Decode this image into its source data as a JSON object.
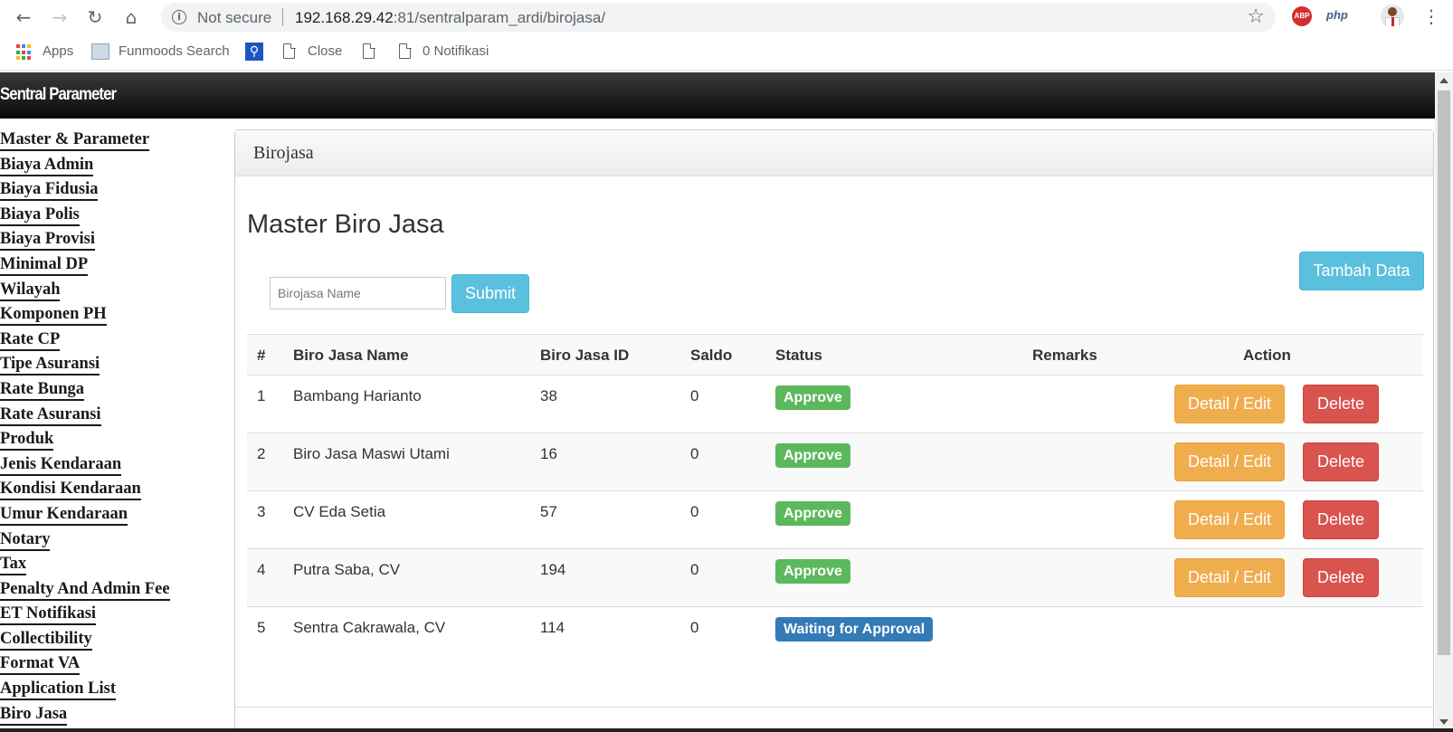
{
  "browser": {
    "security_label": "Not secure",
    "url_host": "192.168.29.42",
    "url_rest": ":81/sentralparam_ardi/birojasa/",
    "extensions": {
      "abp": "ABP",
      "php": "php"
    },
    "bookmarks": [
      {
        "label": "Apps",
        "icon": "apps-grid-icon"
      },
      {
        "label": "Funmoods Search",
        "icon": "funmoods-icon"
      },
      {
        "label": "",
        "icon": "search-icon"
      },
      {
        "label": "Close",
        "icon": "page-icon"
      },
      {
        "label": "",
        "icon": "page-icon"
      },
      {
        "label": "0 Notifikasi",
        "icon": "page-icon"
      }
    ]
  },
  "app": {
    "title": "Sentral Parameter"
  },
  "sidebar": {
    "items": [
      "Master & Parameter",
      "Biaya Admin",
      "Biaya Fidusia",
      "Biaya Polis",
      "Biaya Provisi",
      "Minimal DP",
      "Wilayah",
      "Komponen PH",
      "Rate CP",
      "Tipe Asuransi",
      "Rate Bunga",
      "Rate Asuransi",
      "Produk",
      "Jenis Kendaraan",
      "Kondisi Kendaraan",
      "Umur Kendaraan",
      "Notary",
      "Tax",
      "Penalty And Admin Fee",
      "ET Notifikasi",
      "Collectibility",
      "Format VA",
      "Application List",
      "Biro Jasa"
    ]
  },
  "panel": {
    "heading": "Birojasa",
    "title": "Master Biro Jasa",
    "search_placeholder": "Birojasa Name",
    "submit_label": "Submit",
    "add_label": "Tambah Data"
  },
  "table": {
    "columns": [
      "#",
      "Biro Jasa Name",
      "Biro Jasa ID",
      "Saldo",
      "Status",
      "Remarks",
      "Action"
    ],
    "rows": [
      {
        "no": "1",
        "name": "Bambang Harianto",
        "id": "38",
        "saldo": "0",
        "status": "Approve",
        "remarks": "",
        "edit": "Detail / Edit",
        "delete": "Delete"
      },
      {
        "no": "2",
        "name": "Biro Jasa Maswi Utami",
        "id": "16",
        "saldo": "0",
        "status": "Approve",
        "remarks": "",
        "edit": "Detail / Edit",
        "delete": "Delete"
      },
      {
        "no": "3",
        "name": "CV Eda Setia",
        "id": "57",
        "saldo": "0",
        "status": "Approve",
        "remarks": "",
        "edit": "Detail / Edit",
        "delete": "Delete"
      },
      {
        "no": "4",
        "name": "Putra Saba, CV",
        "id": "194",
        "saldo": "0",
        "status": "Approve",
        "remarks": "",
        "edit": "Detail / Edit",
        "delete": "Delete"
      },
      {
        "no": "5",
        "name": "Sentra Cakrawala, CV",
        "id": "114",
        "saldo": "0",
        "status": "Waiting for Approval",
        "remarks": ""
      }
    ]
  },
  "colors": {
    "approve": "#5cb85c",
    "waiting": "#337ab7",
    "edit": "#f0ad4e",
    "delete": "#d9534f",
    "info": "#5bc0de"
  }
}
